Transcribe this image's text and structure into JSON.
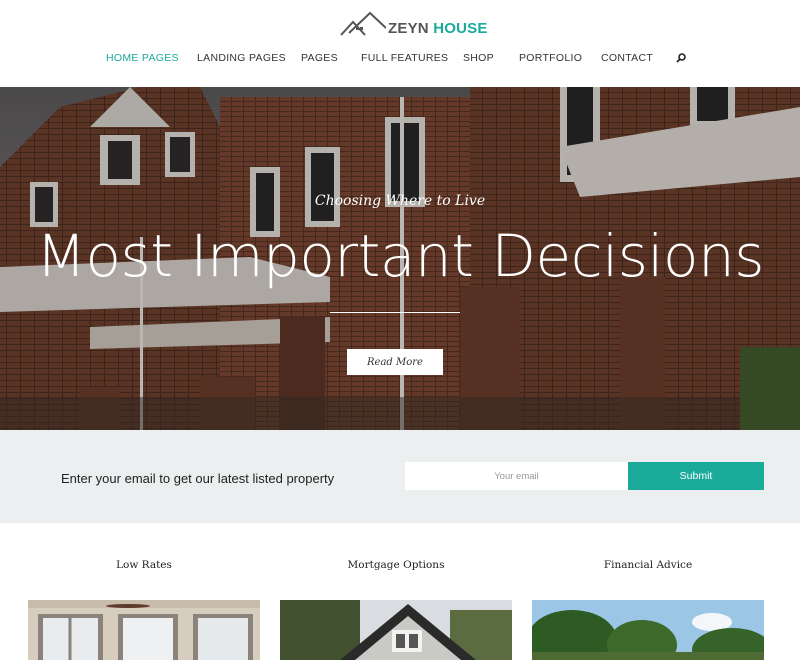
{
  "header": {
    "logo": {
      "part1": "ZEYN",
      "part2": "HOUSE"
    },
    "nav": [
      {
        "label": "HOME PAGES",
        "active": true
      },
      {
        "label": "LANDING PAGES",
        "active": false
      },
      {
        "label": "PAGES",
        "active": false
      },
      {
        "label": "FULL FEATURES",
        "active": false
      },
      {
        "label": "SHOP",
        "active": false
      },
      {
        "label": "PORTFOLIO",
        "active": false
      },
      {
        "label": "CONTACT",
        "active": false
      }
    ],
    "search_icon": "search-icon"
  },
  "hero": {
    "kicker": "Choosing Where to Live",
    "title": "Most Important Decisions",
    "button_label": "Read More"
  },
  "subscribe": {
    "text": "Enter your email to get our latest listed property",
    "input_placeholder": "Your email",
    "button_label": "Submit"
  },
  "features": [
    {
      "title": "Low Rates"
    },
    {
      "title": "Mortgage Options"
    },
    {
      "title": "Financial Advice"
    }
  ],
  "colors": {
    "accent": "#1aab9b",
    "band_background": "#eceff0"
  }
}
